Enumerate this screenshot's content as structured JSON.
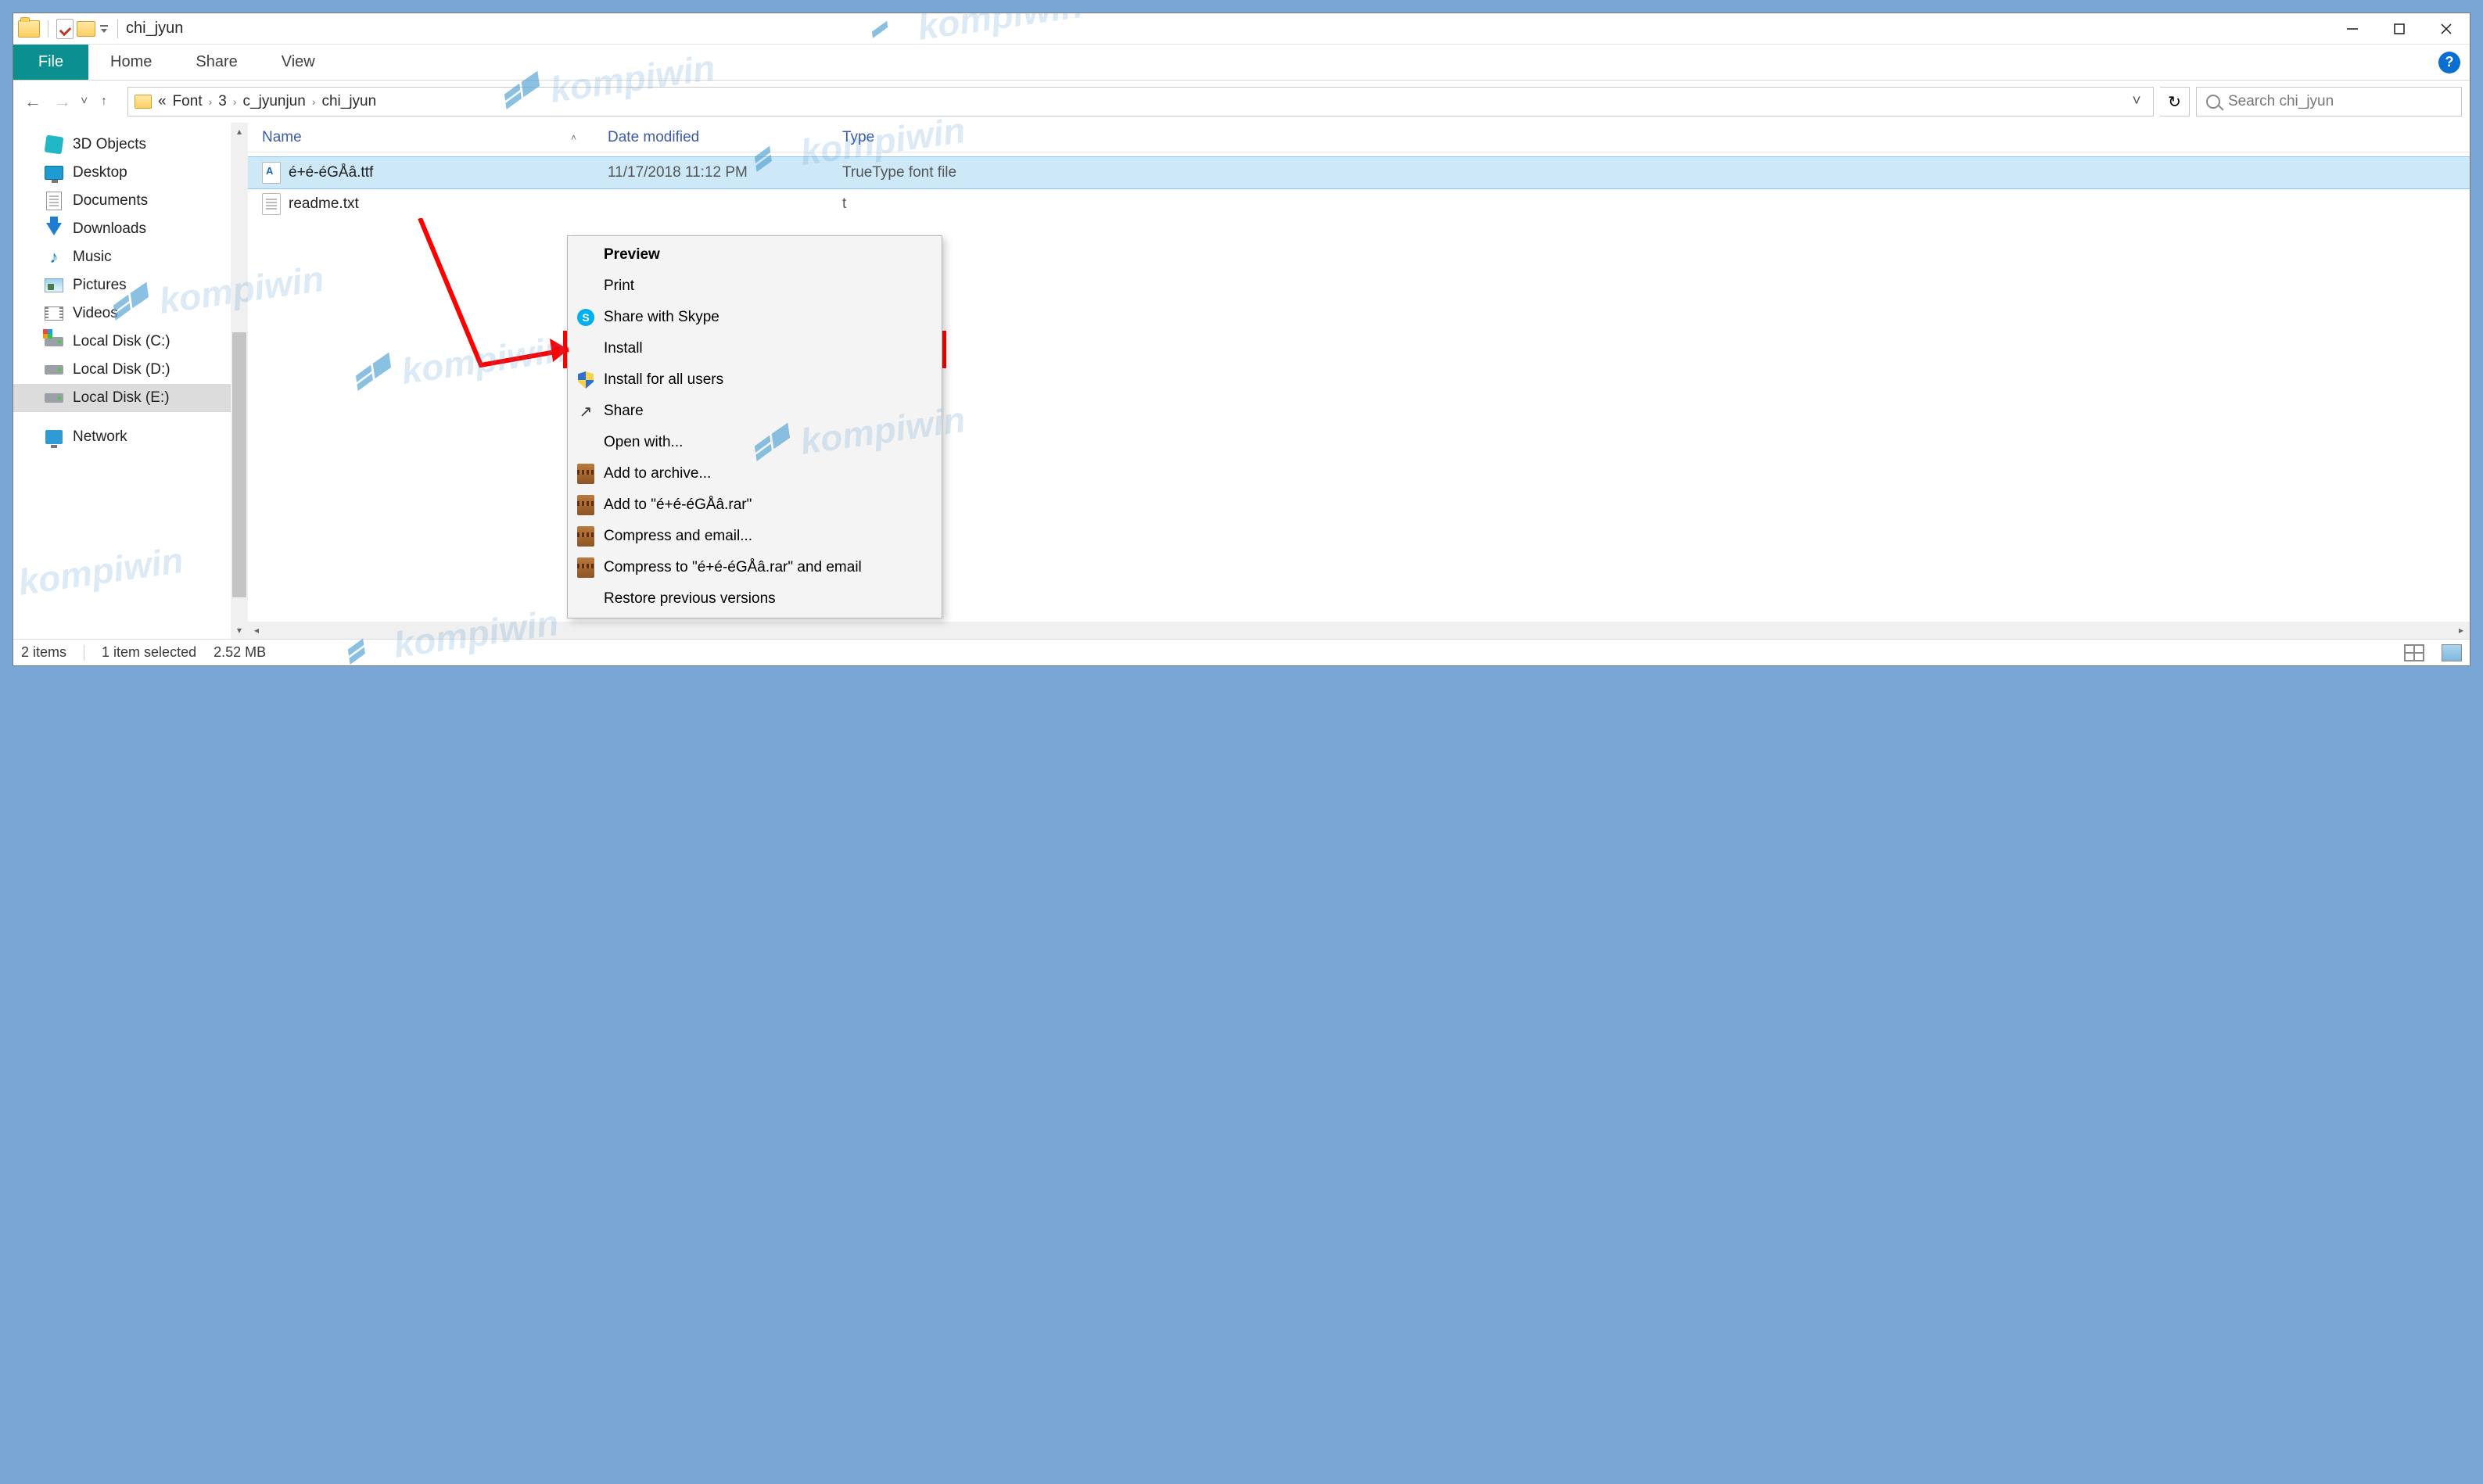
{
  "window_title": "chi_jyun",
  "ribbon": {
    "file": "File",
    "tabs": [
      "Home",
      "Share",
      "View"
    ]
  },
  "breadcrumb": {
    "prefix": "«",
    "items": [
      "Font",
      "3",
      "c_jyunjun",
      "chi_jyun"
    ]
  },
  "search": {
    "placeholder": "Search chi_jyun"
  },
  "nav_items": [
    {
      "key": "3d",
      "label": "3D Objects"
    },
    {
      "key": "desktop",
      "label": "Desktop"
    },
    {
      "key": "documents",
      "label": "Documents"
    },
    {
      "key": "downloads",
      "label": "Downloads"
    },
    {
      "key": "music",
      "label": "Music"
    },
    {
      "key": "pictures",
      "label": "Pictures"
    },
    {
      "key": "videos",
      "label": "Videos"
    },
    {
      "key": "cdrive",
      "label": "Local Disk (C:)"
    },
    {
      "key": "ddrive",
      "label": "Local Disk (D:)"
    },
    {
      "key": "edrive",
      "label": "Local Disk (E:)",
      "selected": true
    },
    {
      "key": "gap"
    },
    {
      "key": "network",
      "label": "Network"
    }
  ],
  "columns": {
    "name": "Name",
    "date": "Date modified",
    "type": "Type"
  },
  "files": [
    {
      "name": "é+é-éGÅâ.ttf",
      "date": "11/17/2018 11:12 PM",
      "type": "TrueType font file",
      "icon": "font",
      "selected": true
    },
    {
      "name": "readme.txt",
      "date": "",
      "type": "t",
      "icon": "txt"
    }
  ],
  "context_menu": {
    "items": [
      {
        "label": "Preview",
        "bold": true
      },
      {
        "label": "Print"
      },
      {
        "label": "Share with Skype",
        "icon": "skype"
      },
      {
        "label": "Install",
        "highlight": true
      },
      {
        "label": "Install for all users",
        "icon": "shield"
      },
      {
        "label": "Share",
        "icon": "share"
      },
      {
        "label": "Open with..."
      },
      {
        "label": "Add to archive...",
        "icon": "rar"
      },
      {
        "label": "Add to \"é+é-éGÅâ.rar\"",
        "icon": "rar"
      },
      {
        "label": "Compress and email...",
        "icon": "rar"
      },
      {
        "label": "Compress to \"é+é-éGÅâ.rar\" and email",
        "icon": "rar"
      },
      {
        "label": "Restore previous versions"
      }
    ]
  },
  "statusbar": {
    "count": "2 items",
    "selection": "1 item selected",
    "size": "2.52 MB"
  },
  "watermark_text": "kompiwin"
}
